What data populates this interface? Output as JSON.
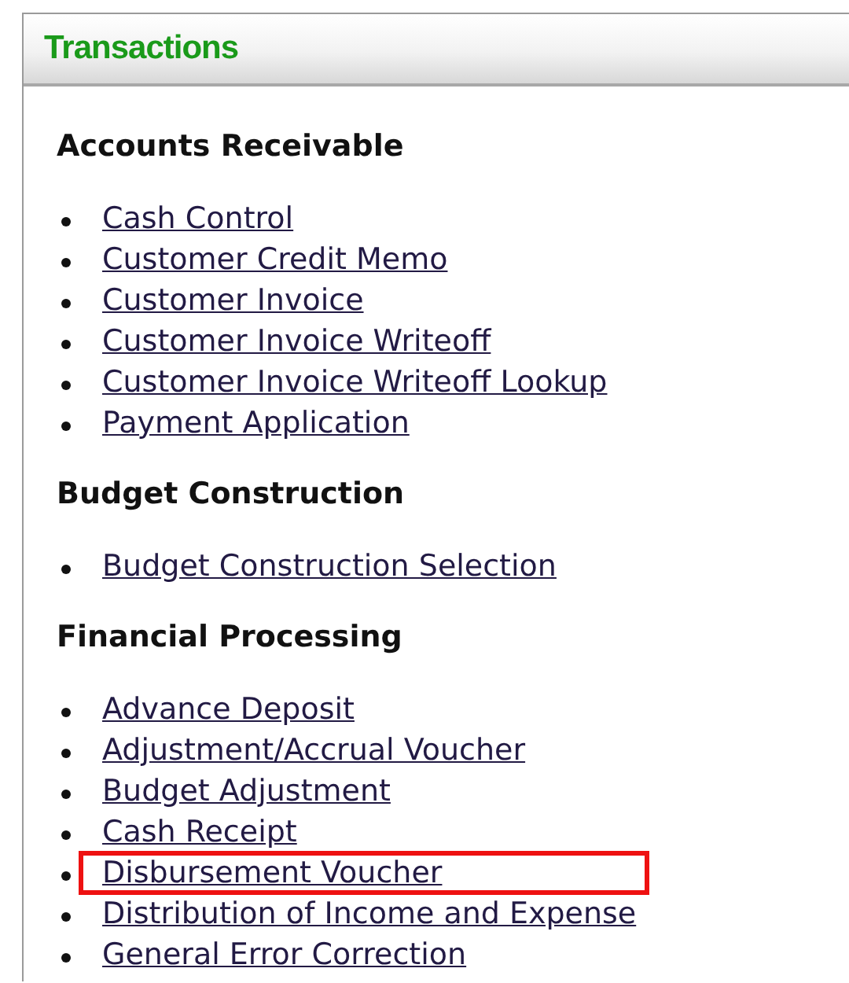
{
  "panel": {
    "title": "Transactions"
  },
  "sections": [
    {
      "heading": "Accounts Receivable",
      "links": [
        {
          "label": "Cash Control",
          "highlighted": false
        },
        {
          "label": "Customer Credit Memo",
          "highlighted": false
        },
        {
          "label": "Customer Invoice",
          "highlighted": false
        },
        {
          "label": "Customer Invoice Writeoff",
          "highlighted": false
        },
        {
          "label": "Customer Invoice Writeoff Lookup",
          "highlighted": false
        },
        {
          "label": "Payment Application",
          "highlighted": false
        }
      ]
    },
    {
      "heading": "Budget Construction",
      "links": [
        {
          "label": "Budget Construction Selection",
          "highlighted": false
        }
      ]
    },
    {
      "heading": "Financial Processing",
      "links": [
        {
          "label": "Advance Deposit",
          "highlighted": false
        },
        {
          "label": "Adjustment/Accrual Voucher",
          "highlighted": false
        },
        {
          "label": "Budget Adjustment",
          "highlighted": false
        },
        {
          "label": "Cash Receipt",
          "highlighted": false
        },
        {
          "label": "Disbursement Voucher",
          "highlighted": true
        },
        {
          "label": "Distribution of Income and Expense",
          "highlighted": false
        },
        {
          "label": "General Error Correction",
          "highlighted": false
        }
      ]
    }
  ]
}
